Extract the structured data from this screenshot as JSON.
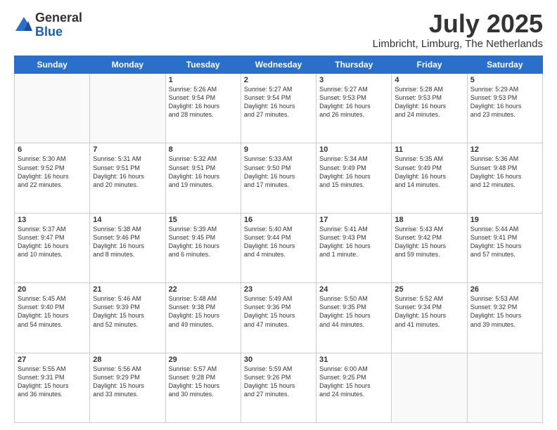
{
  "logo": {
    "general": "General",
    "blue": "Blue"
  },
  "header": {
    "month_title": "July 2025",
    "location": "Limbricht, Limburg, The Netherlands"
  },
  "days_of_week": [
    "Sunday",
    "Monday",
    "Tuesday",
    "Wednesday",
    "Thursday",
    "Friday",
    "Saturday"
  ],
  "weeks": [
    [
      {
        "day": "",
        "content": ""
      },
      {
        "day": "",
        "content": ""
      },
      {
        "day": "1",
        "content": "Sunrise: 5:26 AM\nSunset: 9:54 PM\nDaylight: 16 hours\nand 28 minutes."
      },
      {
        "day": "2",
        "content": "Sunrise: 5:27 AM\nSunset: 9:54 PM\nDaylight: 16 hours\nand 27 minutes."
      },
      {
        "day": "3",
        "content": "Sunrise: 5:27 AM\nSunset: 9:53 PM\nDaylight: 16 hours\nand 26 minutes."
      },
      {
        "day": "4",
        "content": "Sunrise: 5:28 AM\nSunset: 9:53 PM\nDaylight: 16 hours\nand 24 minutes."
      },
      {
        "day": "5",
        "content": "Sunrise: 5:29 AM\nSunset: 9:53 PM\nDaylight: 16 hours\nand 23 minutes."
      }
    ],
    [
      {
        "day": "6",
        "content": "Sunrise: 5:30 AM\nSunset: 9:52 PM\nDaylight: 16 hours\nand 22 minutes."
      },
      {
        "day": "7",
        "content": "Sunrise: 5:31 AM\nSunset: 9:51 PM\nDaylight: 16 hours\nand 20 minutes."
      },
      {
        "day": "8",
        "content": "Sunrise: 5:32 AM\nSunset: 9:51 PM\nDaylight: 16 hours\nand 19 minutes."
      },
      {
        "day": "9",
        "content": "Sunrise: 5:33 AM\nSunset: 9:50 PM\nDaylight: 16 hours\nand 17 minutes."
      },
      {
        "day": "10",
        "content": "Sunrise: 5:34 AM\nSunset: 9:49 PM\nDaylight: 16 hours\nand 15 minutes."
      },
      {
        "day": "11",
        "content": "Sunrise: 5:35 AM\nSunset: 9:49 PM\nDaylight: 16 hours\nand 14 minutes."
      },
      {
        "day": "12",
        "content": "Sunrise: 5:36 AM\nSunset: 9:48 PM\nDaylight: 16 hours\nand 12 minutes."
      }
    ],
    [
      {
        "day": "13",
        "content": "Sunrise: 5:37 AM\nSunset: 9:47 PM\nDaylight: 16 hours\nand 10 minutes."
      },
      {
        "day": "14",
        "content": "Sunrise: 5:38 AM\nSunset: 9:46 PM\nDaylight: 16 hours\nand 8 minutes."
      },
      {
        "day": "15",
        "content": "Sunrise: 5:39 AM\nSunset: 9:45 PM\nDaylight: 16 hours\nand 6 minutes."
      },
      {
        "day": "16",
        "content": "Sunrise: 5:40 AM\nSunset: 9:44 PM\nDaylight: 16 hours\nand 4 minutes."
      },
      {
        "day": "17",
        "content": "Sunrise: 5:41 AM\nSunset: 9:43 PM\nDaylight: 16 hours\nand 1 minute."
      },
      {
        "day": "18",
        "content": "Sunrise: 5:43 AM\nSunset: 9:42 PM\nDaylight: 15 hours\nand 59 minutes."
      },
      {
        "day": "19",
        "content": "Sunrise: 5:44 AM\nSunset: 9:41 PM\nDaylight: 15 hours\nand 57 minutes."
      }
    ],
    [
      {
        "day": "20",
        "content": "Sunrise: 5:45 AM\nSunset: 9:40 PM\nDaylight: 15 hours\nand 54 minutes."
      },
      {
        "day": "21",
        "content": "Sunrise: 5:46 AM\nSunset: 9:39 PM\nDaylight: 15 hours\nand 52 minutes."
      },
      {
        "day": "22",
        "content": "Sunrise: 5:48 AM\nSunset: 9:38 PM\nDaylight: 15 hours\nand 49 minutes."
      },
      {
        "day": "23",
        "content": "Sunrise: 5:49 AM\nSunset: 9:36 PM\nDaylight: 15 hours\nand 47 minutes."
      },
      {
        "day": "24",
        "content": "Sunrise: 5:50 AM\nSunset: 9:35 PM\nDaylight: 15 hours\nand 44 minutes."
      },
      {
        "day": "25",
        "content": "Sunrise: 5:52 AM\nSunset: 9:34 PM\nDaylight: 15 hours\nand 41 minutes."
      },
      {
        "day": "26",
        "content": "Sunrise: 5:53 AM\nSunset: 9:32 PM\nDaylight: 15 hours\nand 39 minutes."
      }
    ],
    [
      {
        "day": "27",
        "content": "Sunrise: 5:55 AM\nSunset: 9:31 PM\nDaylight: 15 hours\nand 36 minutes."
      },
      {
        "day": "28",
        "content": "Sunrise: 5:56 AM\nSunset: 9:29 PM\nDaylight: 15 hours\nand 33 minutes."
      },
      {
        "day": "29",
        "content": "Sunrise: 5:57 AM\nSunset: 9:28 PM\nDaylight: 15 hours\nand 30 minutes."
      },
      {
        "day": "30",
        "content": "Sunrise: 5:59 AM\nSunset: 9:26 PM\nDaylight: 15 hours\nand 27 minutes."
      },
      {
        "day": "31",
        "content": "Sunrise: 6:00 AM\nSunset: 9:25 PM\nDaylight: 15 hours\nand 24 minutes."
      },
      {
        "day": "",
        "content": ""
      },
      {
        "day": "",
        "content": ""
      }
    ]
  ]
}
